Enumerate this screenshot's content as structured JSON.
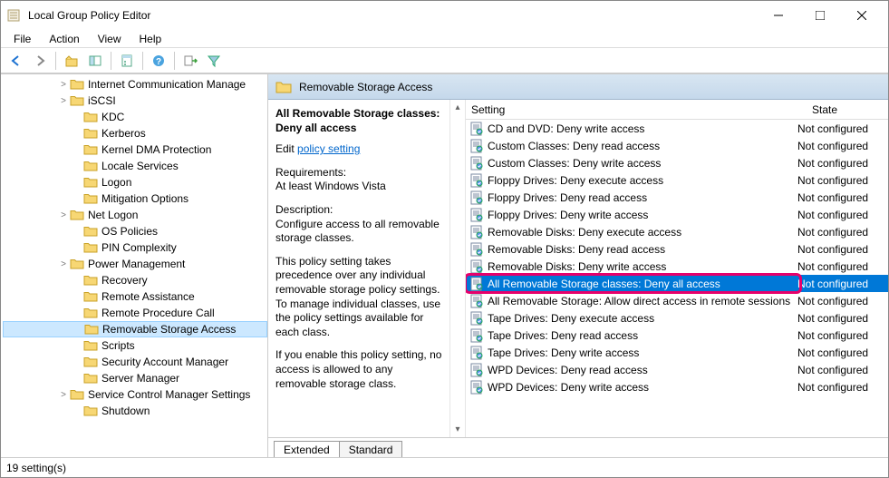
{
  "window": {
    "title": "Local Group Policy Editor"
  },
  "menubar": [
    "File",
    "Action",
    "View",
    "Help"
  ],
  "tree": [
    {
      "label": "Internet Communication Manage",
      "arrow": ">",
      "level": 1
    },
    {
      "label": "iSCSI",
      "arrow": ">",
      "level": 1
    },
    {
      "label": "KDC",
      "arrow": "",
      "level": 2
    },
    {
      "label": "Kerberos",
      "arrow": "",
      "level": 2
    },
    {
      "label": "Kernel DMA Protection",
      "arrow": "",
      "level": 2
    },
    {
      "label": "Locale Services",
      "arrow": "",
      "level": 2
    },
    {
      "label": "Logon",
      "arrow": "",
      "level": 2
    },
    {
      "label": "Mitigation Options",
      "arrow": "",
      "level": 2
    },
    {
      "label": "Net Logon",
      "arrow": ">",
      "level": 1
    },
    {
      "label": "OS Policies",
      "arrow": "",
      "level": 2
    },
    {
      "label": "PIN Complexity",
      "arrow": "",
      "level": 2
    },
    {
      "label": "Power Management",
      "arrow": ">",
      "level": 1
    },
    {
      "label": "Recovery",
      "arrow": "",
      "level": 2
    },
    {
      "label": "Remote Assistance",
      "arrow": "",
      "level": 2
    },
    {
      "label": "Remote Procedure Call",
      "arrow": "",
      "level": 2
    },
    {
      "label": "Removable Storage Access",
      "arrow": "",
      "level": 2,
      "selected": true
    },
    {
      "label": "Scripts",
      "arrow": "",
      "level": 2
    },
    {
      "label": "Security Account Manager",
      "arrow": "",
      "level": 2
    },
    {
      "label": "Server Manager",
      "arrow": "",
      "level": 2
    },
    {
      "label": "Service Control Manager Settings",
      "arrow": ">",
      "level": 1
    },
    {
      "label": "Shutdown",
      "arrow": "",
      "level": 2
    }
  ],
  "headerTitle": "Removable Storage Access",
  "desc": {
    "title": "All Removable Storage classes: Deny all access",
    "editPrefix": "Edit ",
    "editLink": "policy setting ",
    "reqLabel": "Requirements:",
    "reqText": "At least Windows Vista",
    "descLabel": "Description:",
    "descText": "Configure access to all removable storage classes.",
    "p1": "This policy setting takes precedence over any individual removable storage policy settings. To manage individual classes, use the policy settings available for each class.",
    "p2": "If you enable this policy setting, no access is allowed to any removable storage class."
  },
  "listHeader": {
    "setting": "Setting",
    "state": "State"
  },
  "rows": [
    {
      "text": "CD and DVD: Deny write access",
      "state": "Not configured"
    },
    {
      "text": "Custom Classes: Deny read access",
      "state": "Not configured"
    },
    {
      "text": "Custom Classes: Deny write access",
      "state": "Not configured"
    },
    {
      "text": "Floppy Drives: Deny execute access",
      "state": "Not configured"
    },
    {
      "text": "Floppy Drives: Deny read access",
      "state": "Not configured"
    },
    {
      "text": "Floppy Drives: Deny write access",
      "state": "Not configured"
    },
    {
      "text": "Removable Disks: Deny execute access",
      "state": "Not configured"
    },
    {
      "text": "Removable Disks: Deny read access",
      "state": "Not configured"
    },
    {
      "text": "Removable Disks: Deny write access",
      "state": "Not configured"
    },
    {
      "text": "All Removable Storage classes: Deny all access",
      "state": "Not configured",
      "selected": true,
      "highlight": true
    },
    {
      "text": "All Removable Storage: Allow direct access in remote sessions",
      "state": "Not configured"
    },
    {
      "text": "Tape Drives: Deny execute access",
      "state": "Not configured"
    },
    {
      "text": "Tape Drives: Deny read access",
      "state": "Not configured"
    },
    {
      "text": "Tape Drives: Deny write access",
      "state": "Not configured"
    },
    {
      "text": "WPD Devices: Deny read access",
      "state": "Not configured"
    },
    {
      "text": "WPD Devices: Deny write access",
      "state": "Not configured"
    }
  ],
  "tabs": {
    "extended": "Extended",
    "standard": "Standard"
  },
  "status": "19 setting(s)"
}
